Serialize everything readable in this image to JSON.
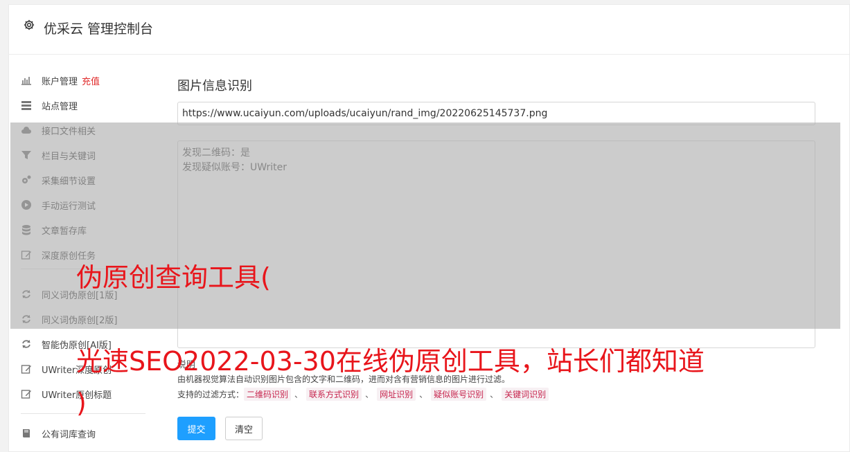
{
  "app": {
    "title": "优采云 管理控制台",
    "icon": "gear-icon"
  },
  "sidebar": {
    "items": [
      {
        "label": "账户管理",
        "badge": "充值",
        "icon": "bar-chart-icon"
      },
      {
        "label": "站点管理",
        "icon": "server-icon"
      },
      {
        "label": "接口文件相关",
        "icon": "cloud-upload-icon"
      },
      {
        "label": "栏目与关键词",
        "icon": "filter-icon"
      },
      {
        "label": "采集细节设置",
        "icon": "cogs-icon"
      },
      {
        "label": "手动运行测试",
        "icon": "play-circle-icon"
      },
      {
        "label": "文章暂存库",
        "icon": "database-icon"
      },
      {
        "label": "深度原创任务",
        "icon": "edit-icon"
      },
      {
        "label": "同义词伪原创[1版]",
        "icon": "refresh-icon"
      },
      {
        "label": "同义词伪原创[2版]",
        "icon": "refresh-icon"
      },
      {
        "label": "智能伪原创[AI版]",
        "icon": "refresh-icon"
      },
      {
        "label": "UWriter深度原创",
        "icon": "edit-icon"
      },
      {
        "label": "UWriter原创标题",
        "icon": "edit-icon"
      },
      {
        "label": "公有词库查询",
        "icon": "book-icon"
      }
    ]
  },
  "main": {
    "title": "图片信息识别",
    "url_value": "https://www.ucaiyun.com/uploads/ucaiyun/rand_img/20220625145737.png",
    "result_lines": [
      "发现二维码：是",
      "发现疑似账号：UWriter"
    ],
    "note_label": "说明",
    "note_text": "由机器视觉算法自动识别图片包含的文字和二维码，进而对含有营销信息的图片进行过滤。",
    "filters_label": "支持的过滤方式：",
    "filters": [
      "二维码识别",
      "联系方式识别",
      "网址识别",
      "疑似账号识别",
      "关键词识别"
    ],
    "filter_separator": "、",
    "submit_label": "提交",
    "clear_label": "清空"
  },
  "overlay": {
    "line1": "伪原创查询工具(",
    "line2": "光速SEO2022-03-30在线伪原创工具，站长们都知道",
    "line3": ")",
    "color": "#e8151b"
  }
}
